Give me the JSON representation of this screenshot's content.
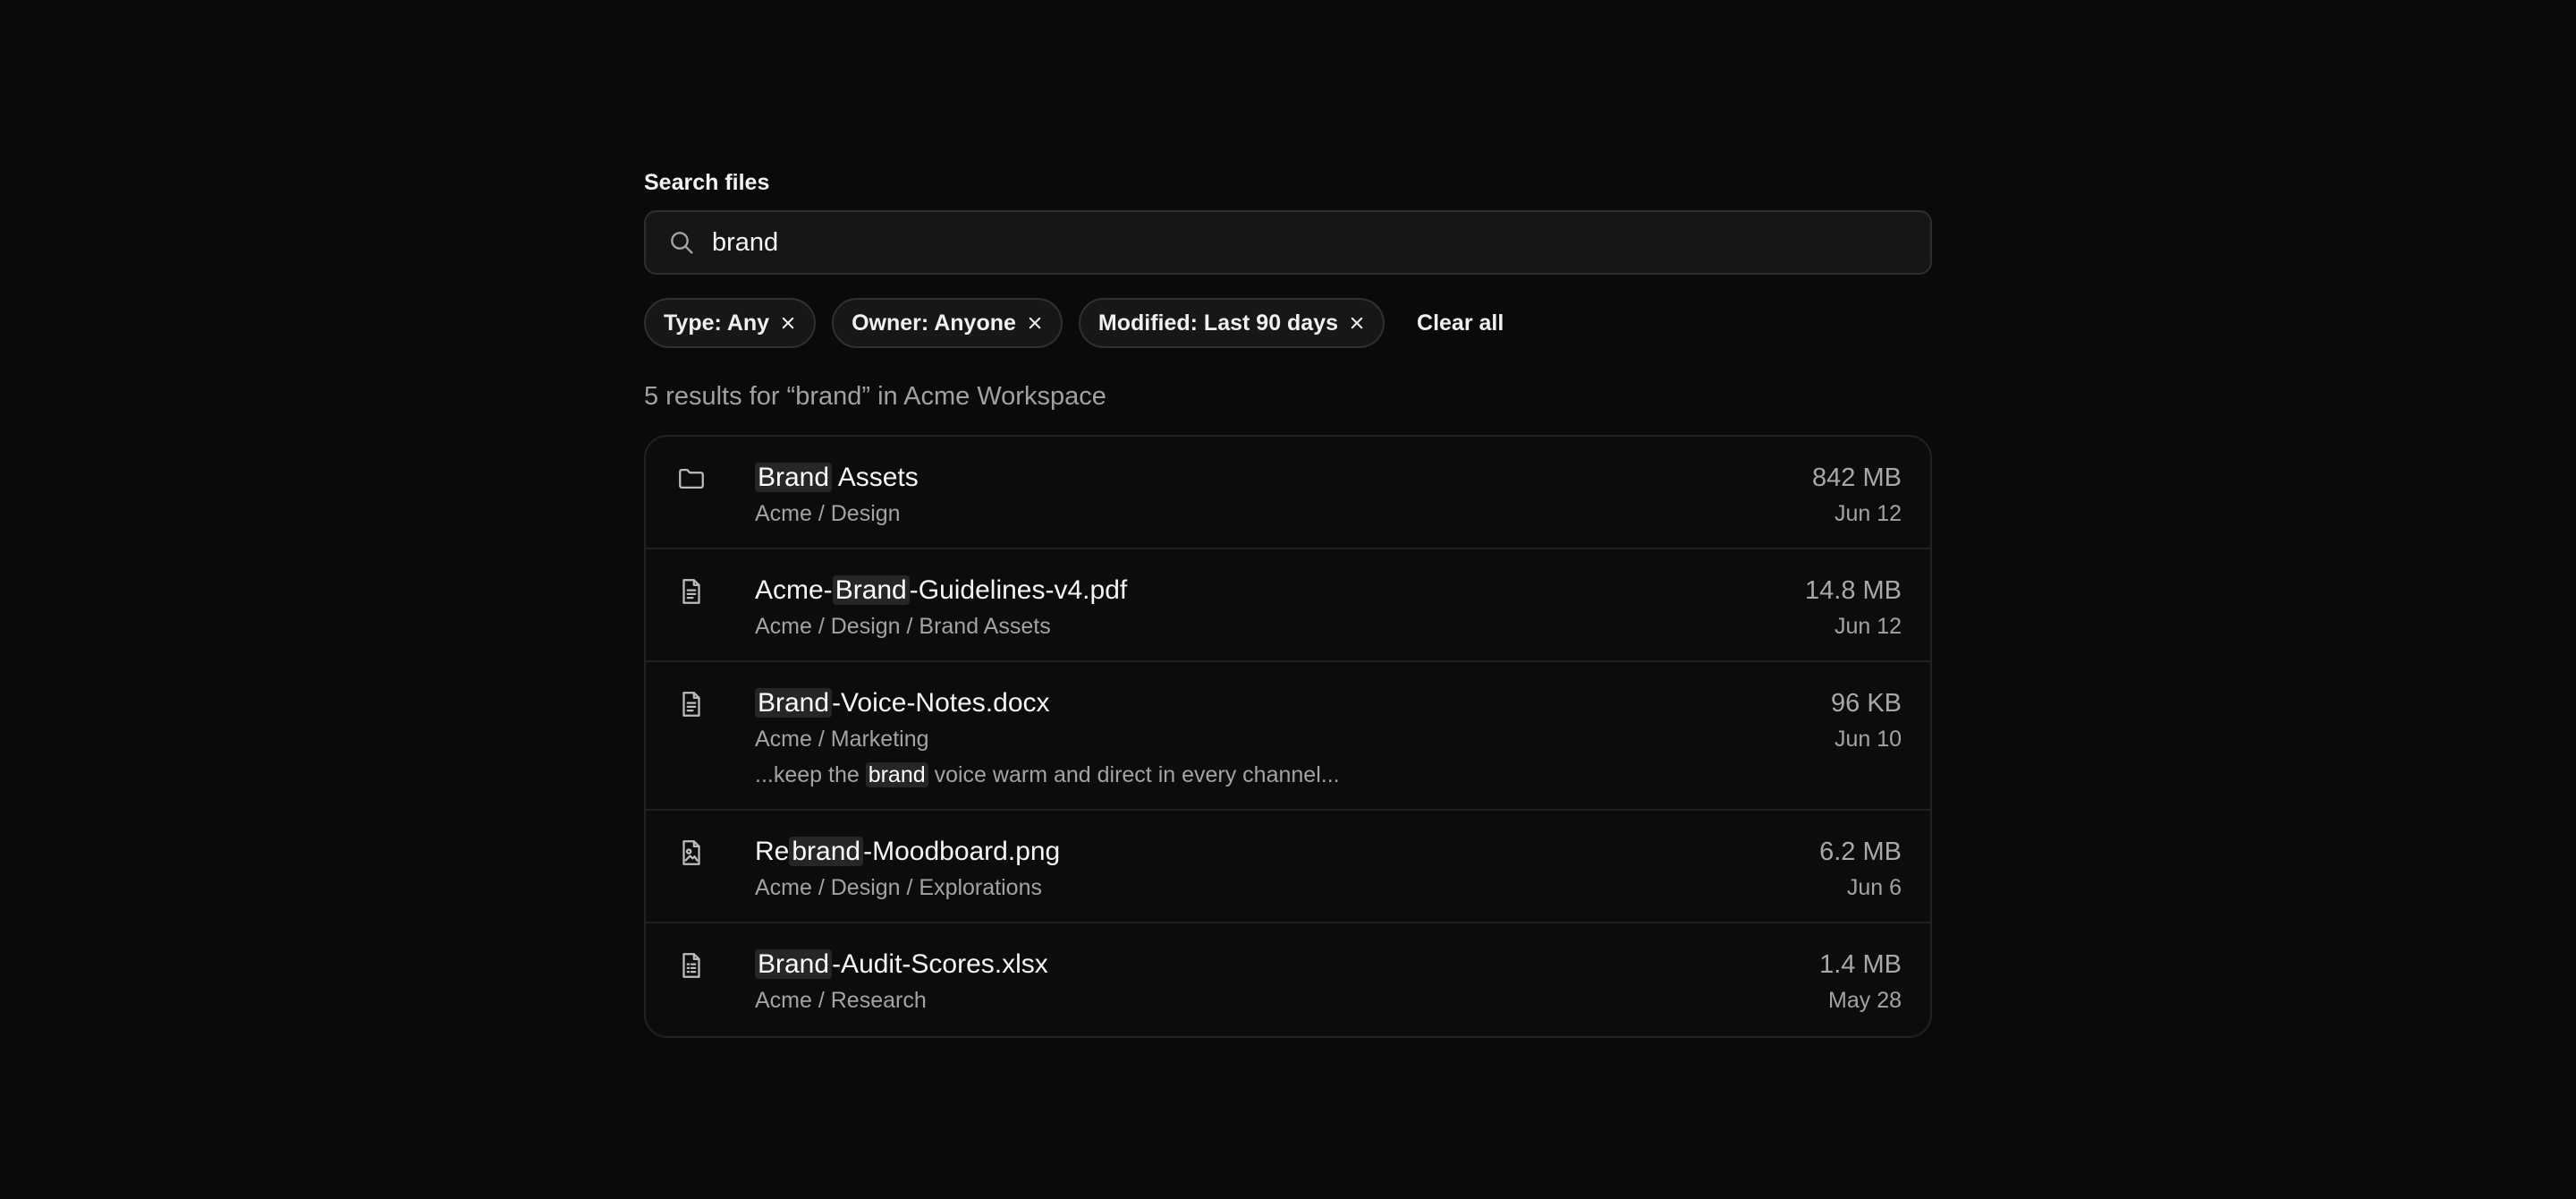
{
  "search": {
    "label": "Search files",
    "value": "brand",
    "icon": "search-icon"
  },
  "filters": [
    {
      "label": "Type: Any"
    },
    {
      "label": "Owner: Anyone"
    },
    {
      "label": "Modified: Last 90 days"
    }
  ],
  "clear_all_label": "Clear all",
  "summary": "5 results for “brand” in Acme Workspace",
  "results": [
    {
      "icon": "folder-icon",
      "name_pre": "",
      "name_hl": "Brand",
      "name_post": " Assets",
      "path": "Acme / Design",
      "size": "842 MB",
      "date": "Jun 12"
    },
    {
      "icon": "document-icon",
      "name_pre": "Acme-",
      "name_hl": "Brand",
      "name_post": "-Guidelines-v4.pdf",
      "path": "Acme / Design / Brand Assets",
      "size": "14.8 MB",
      "date": "Jun 12"
    },
    {
      "icon": "document-icon",
      "name_pre": "",
      "name_hl": "Brand",
      "name_post": "-Voice-Notes.docx",
      "path": "Acme / Marketing",
      "snippet_pre": "...keep the ",
      "snippet_hl": "brand",
      "snippet_post": " voice warm and direct in every channel...",
      "size": "96 KB",
      "date": "Jun 10"
    },
    {
      "icon": "image-file-icon",
      "name_pre": "Re",
      "name_hl": "brand",
      "name_post": "-Moodboard.png",
      "path": "Acme / Design / Explorations",
      "size": "6.2 MB",
      "date": "Jun 6"
    },
    {
      "icon": "spreadsheet-icon",
      "name_pre": "",
      "name_hl": "Brand",
      "name_post": "-Audit-Scores.xlsx",
      "path": "Acme / Research",
      "size": "1.4 MB",
      "date": "May 28"
    }
  ]
}
